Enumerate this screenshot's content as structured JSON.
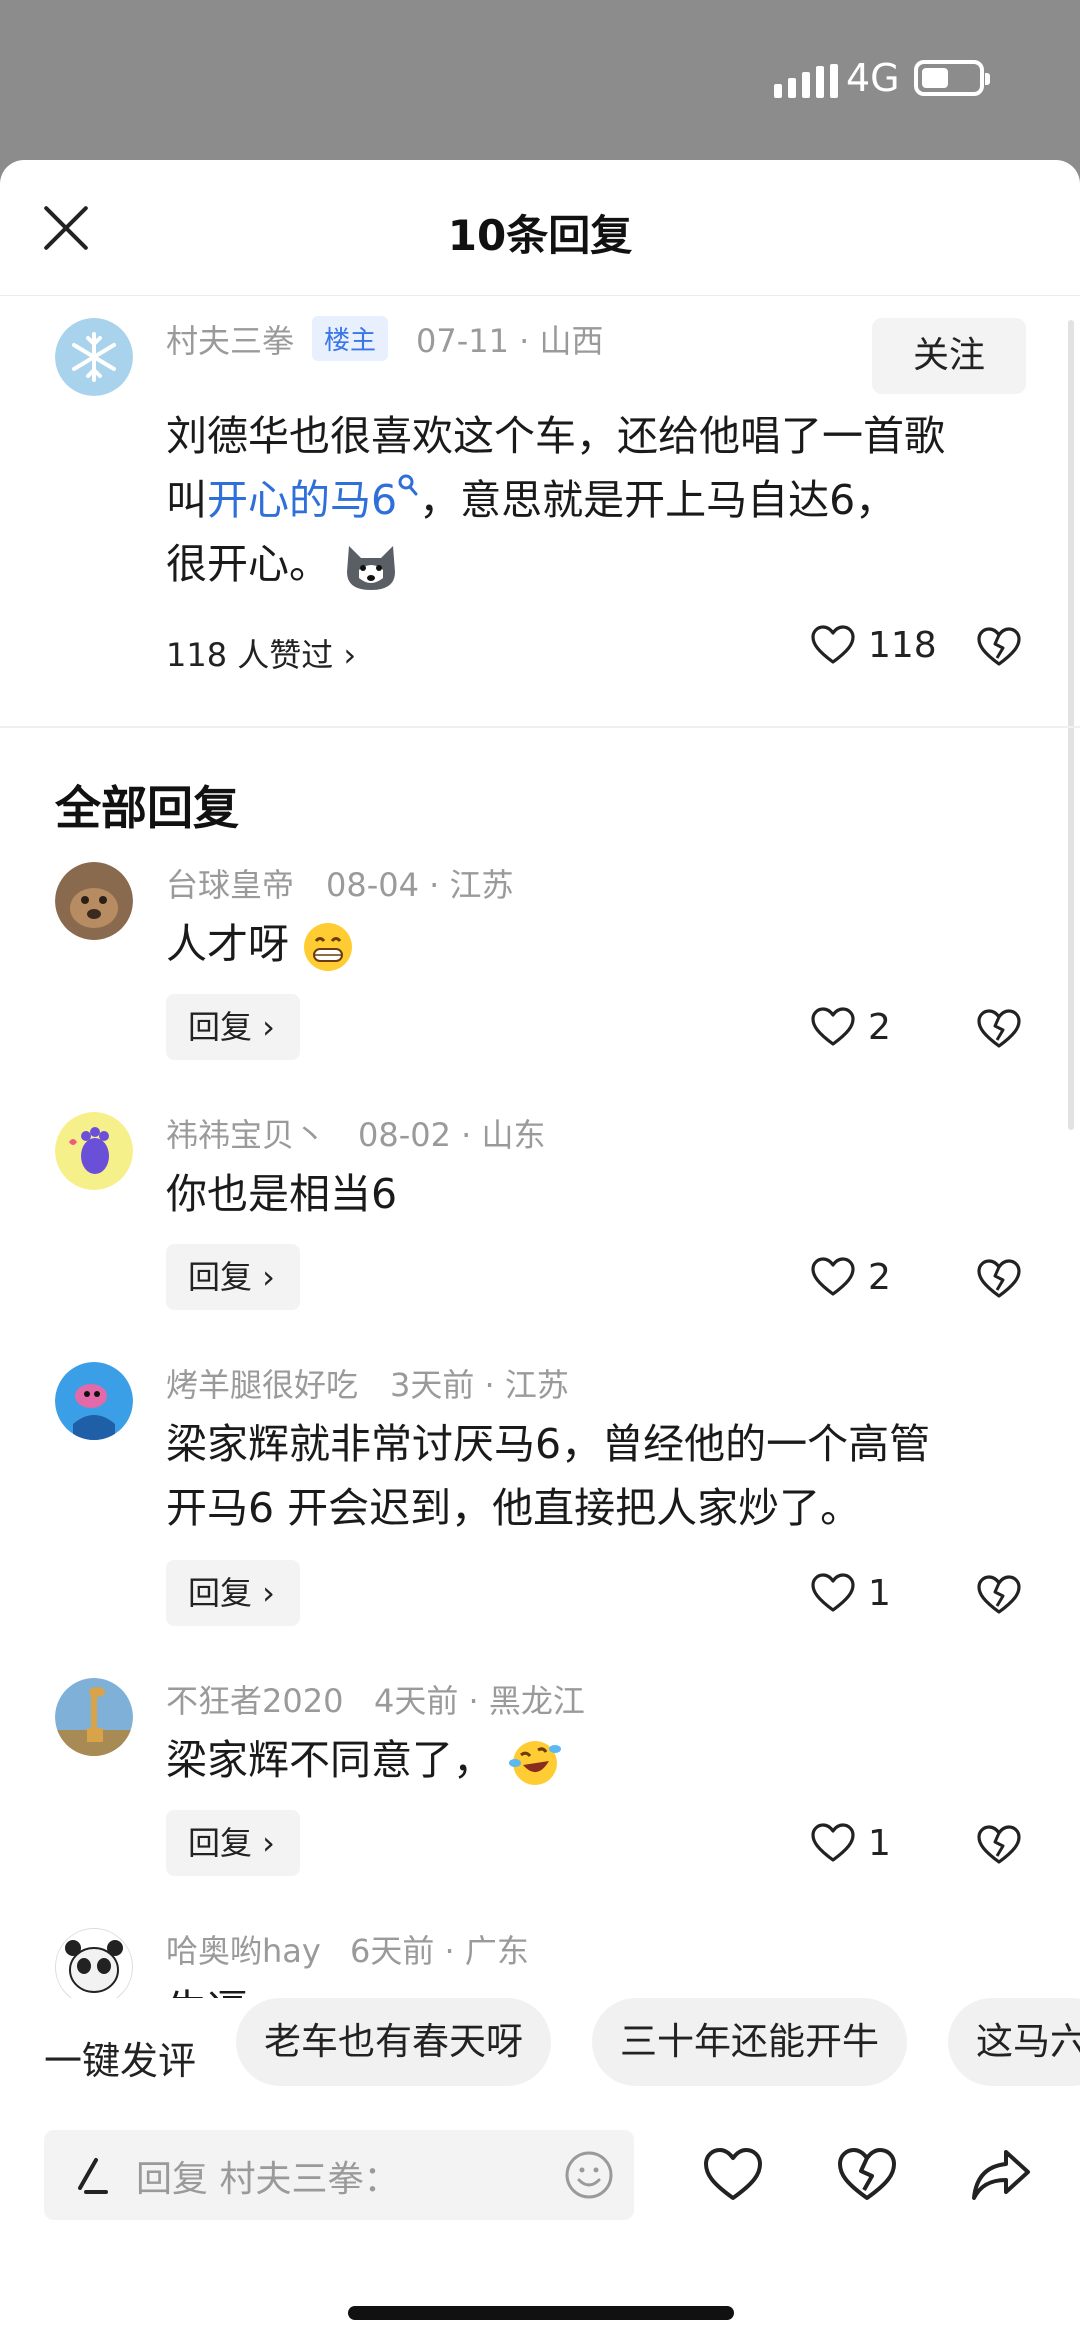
{
  "status_bar": {
    "network": "4G"
  },
  "header": {
    "title": "10条回复",
    "close_icon": "close-icon"
  },
  "main_comment": {
    "username": "村夫三拳",
    "badge": "楼主",
    "meta": "07-11 · 山西",
    "follow_label": "关注",
    "text_line1": "刘德华也很喜欢这个车，还给他唱了一首歌",
    "text_line2_prefix": "叫",
    "text_link": "开心的马6",
    "text_line2_suffix": "，意思就是开上马自达6，",
    "text_line3": "很开心。",
    "liked_by": "118 人赞过 ›",
    "like_count": "118"
  },
  "section_title": "全部回复",
  "replies": [
    {
      "username": "台球皇帝",
      "meta": "08-04 · 江苏",
      "text": "人才呀",
      "reply_label": "回复 ›",
      "like_count": "2"
    },
    {
      "username": "祎祎宝贝丶",
      "meta": "08-02 · 山东",
      "text": "你也是相当6",
      "reply_label": "回复 ›",
      "like_count": "2"
    },
    {
      "username": "烤羊腿很好吃",
      "meta": "3天前 · 江苏",
      "text_line1": "梁家辉就非常讨厌马6，曾经他的一个高管",
      "text_line2": "开马6 开会迟到，他直接把人家炒了。",
      "reply_label": "回复 ›",
      "like_count": "1"
    },
    {
      "username": "不狂者2020",
      "meta": "4天前 · 黑龙江",
      "text": "梁家辉不同意了，",
      "reply_label": "回复 ›",
      "like_count": "1"
    },
    {
      "username": "哈奥哟hay",
      "meta": "6天前 · 广东",
      "text": "牛逼"
    }
  ],
  "bottom": {
    "quick_label": "一键发评",
    "chips": [
      "老车也有春天呀",
      "三十年还能开牛",
      "这马六"
    ],
    "input_placeholder": "回复 村夫三拳："
  },
  "colors": {
    "link": "#2f6fd9",
    "badge_bg": "#e8f0fd",
    "status_bg": "#8c8c8c"
  }
}
